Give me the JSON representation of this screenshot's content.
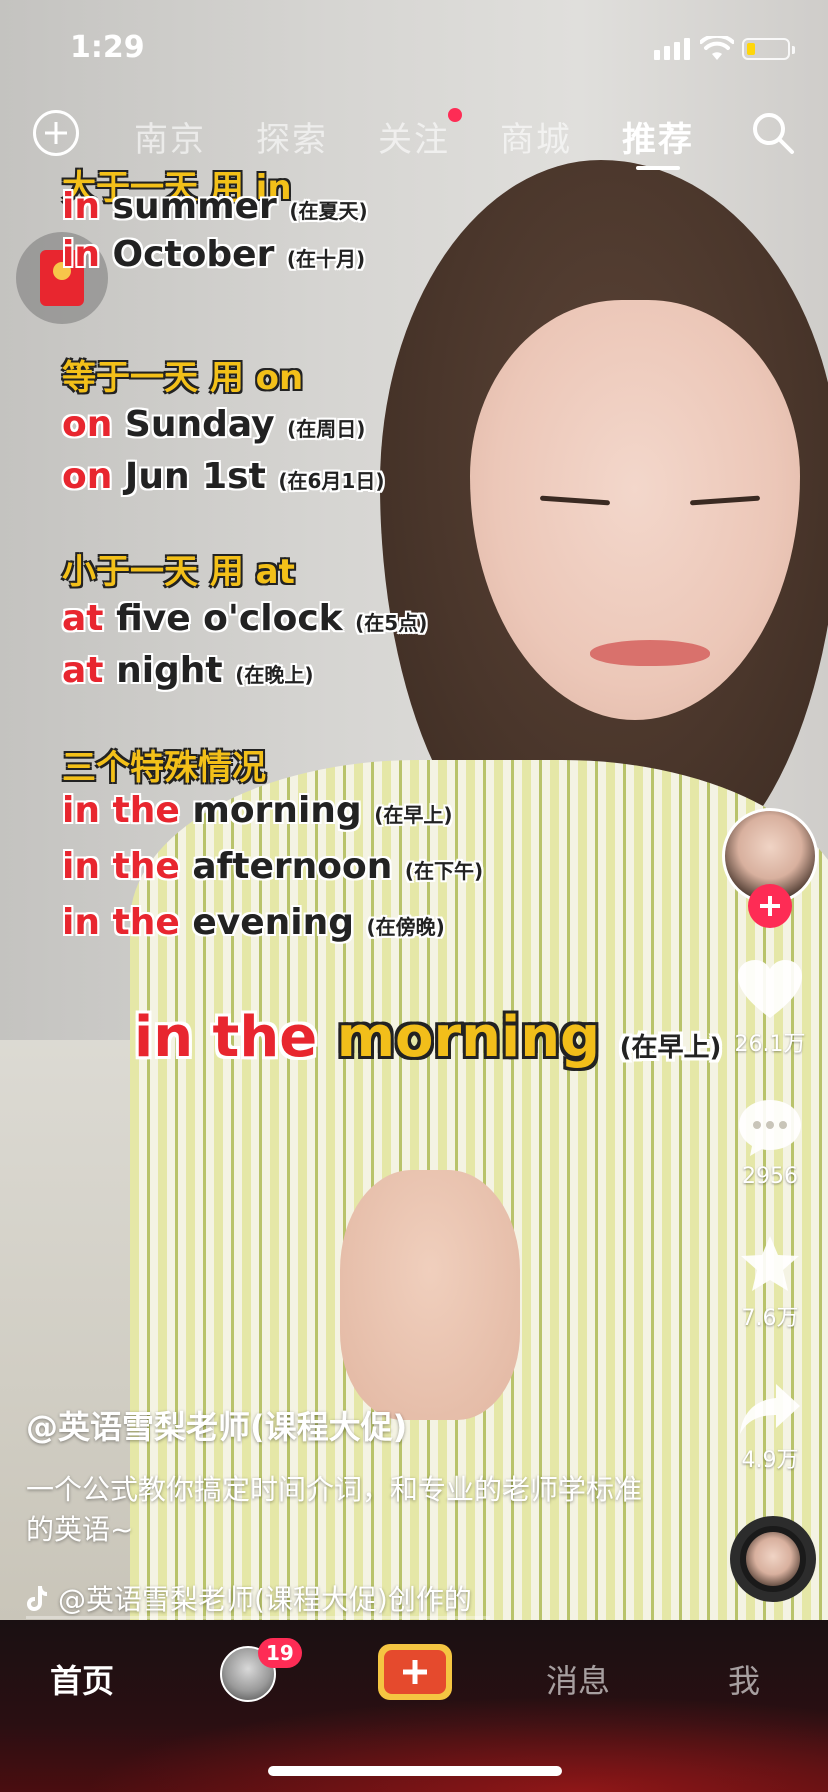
{
  "status": {
    "time": "1:29",
    "battery_level": 0.2
  },
  "topnav": {
    "tabs": [
      {
        "label": "南京",
        "active": false
      },
      {
        "label": "探索",
        "active": false
      },
      {
        "label": "关注",
        "active": false,
        "has_dot": true
      },
      {
        "label": "商城",
        "active": false
      },
      {
        "label": "推荐",
        "active": true
      }
    ]
  },
  "lesson": {
    "head1": {
      "pre": "大于一天",
      "hl": "用 in"
    },
    "r1a": {
      "kw": "in",
      "word": "summer",
      "note": "(在夏天)"
    },
    "r1b": {
      "kw": "in",
      "word": "October",
      "note": "(在十月)"
    },
    "head2": {
      "pre": "等于一天",
      "hl": "用 on"
    },
    "r2a": {
      "kw": "on",
      "word": "Sunday",
      "note": "(在周日)"
    },
    "r2b": {
      "kw": "on",
      "word": "Jun 1st",
      "note": "(在6月1日)"
    },
    "head3": {
      "pre": "小于一天",
      "hl": "用 at"
    },
    "r3a": {
      "kw": "at",
      "word": "five o'clock",
      "note": "(在5点)"
    },
    "r3b": {
      "kw": "at",
      "word": "night",
      "note": "(在晚上)"
    },
    "head4": {
      "pre": "三个特殊情况"
    },
    "r4a": {
      "kw": "in the",
      "word": "morning",
      "note": "(在早上)"
    },
    "r4b": {
      "kw": "in the",
      "word": "afternoon",
      "note": "(在下午)"
    },
    "r4c": {
      "kw": "in the",
      "word": "evening",
      "note": "(在傍晚)"
    }
  },
  "big_caption": {
    "kw": "in the",
    "word": "morning",
    "note": "(在早上)"
  },
  "rail": {
    "likes": "26.1万",
    "comments": "2956",
    "favorites": "7.6万",
    "shares": "4.9万"
  },
  "caption": {
    "author": "@英语雪梨老师(课程大促)",
    "description": "一个公式教你搞定时间介词，和专业的老师学标准的英语~",
    "music": "@英语雪梨老师(课程大促)创作的"
  },
  "tabbar": {
    "home": "首页",
    "friends_badge": "19",
    "messages": "消息",
    "me": "我"
  },
  "colors": {
    "accent": "#fe2c55",
    "kw_red": "#e8262f",
    "kw_yellow": "#f3c019"
  }
}
